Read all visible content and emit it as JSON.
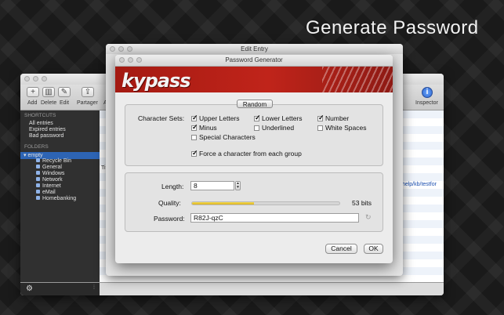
{
  "headline": "Generate Password",
  "main_window": {
    "toolbar": {
      "add_label": "Add",
      "delete_label": "Delete",
      "edit_label": "Edit",
      "share_label": "Partager",
      "more_label": "A",
      "inspector_label": "Inspector"
    },
    "sidebar": {
      "shortcuts_heading": "SHORTCUTS",
      "shortcuts": [
        "All entries",
        "Expired entries",
        "Bad password"
      ],
      "folders_heading": "FOLDERS",
      "root_folder": "empty",
      "folders": [
        "Recycle Bin",
        "General",
        "Windows",
        "Network",
        "Internet",
        "eMail",
        "Homebanking"
      ]
    },
    "content": {
      "column_stub": "Tit",
      "url_fragment_1": "/",
      "url_fragment_2": "/help/kb/testfor"
    }
  },
  "edit_window": {
    "title": "Edit Entry"
  },
  "generator": {
    "title": "Password Generator",
    "logo": "kypass",
    "tab_label": "Random",
    "character_sets_label": "Character Sets:",
    "options": {
      "upper": {
        "label": "Upper Letters",
        "checked": true
      },
      "lower": {
        "label": "Lower Letters",
        "checked": true
      },
      "number": {
        "label": "Number",
        "checked": true
      },
      "minus": {
        "label": "Minus",
        "checked": true
      },
      "underlined": {
        "label": "Underlined",
        "checked": false
      },
      "whitespaces": {
        "label": "White Spaces",
        "checked": false
      },
      "special": {
        "label": "Special Characters",
        "checked": false
      },
      "force": {
        "label": "Force a character from each group",
        "checked": true
      }
    },
    "length_label": "Length:",
    "length_value": "8",
    "quality_label": "Quality:",
    "quality_fraction": 0.42,
    "quality_text": "53 bits",
    "password_label": "Password:",
    "password_value": "R82J-qzC",
    "cancel_label": "Cancel",
    "ok_label": "OK"
  }
}
